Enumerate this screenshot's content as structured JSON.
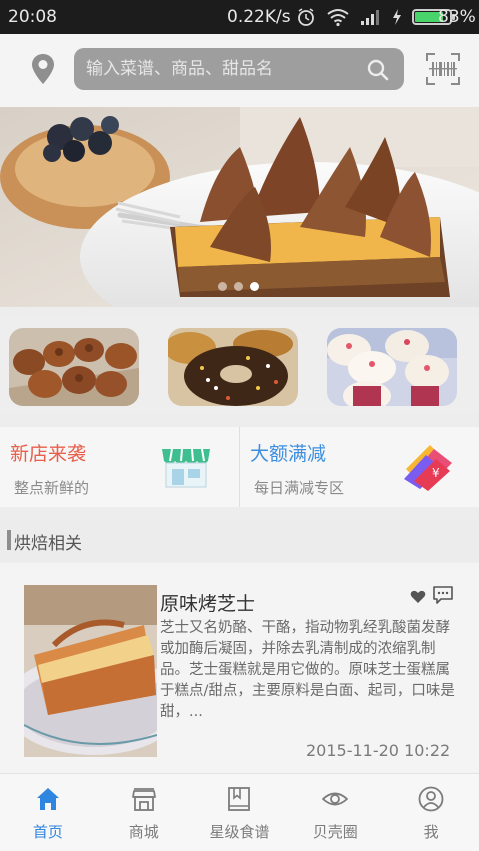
{
  "status_bar": {
    "time": "20:08",
    "network_speed": "0.22K/s",
    "battery_percent": "83%",
    "battery_level": 0.83,
    "icons": [
      "alarm-icon",
      "wifi-icon",
      "signal-icon",
      "charging-icon",
      "battery-icon"
    ]
  },
  "header": {
    "search_placeholder": "输入菜谱、商品、甜品名",
    "location_icon": "location-pin-icon",
    "search_icon": "search-icon",
    "scan_icon": "barcode-scan-icon"
  },
  "banner": {
    "slide_count": 3,
    "active_slide": 3
  },
  "promo": {
    "left": {
      "title": "新店来袭",
      "subtitle": "整点新鲜的",
      "title_color": "#e8604c",
      "icon": "shop-icon"
    },
    "right": {
      "title": "大额满减",
      "subtitle": "每日满减专区",
      "title_color": "#3d8fe0",
      "icon": "coupon-icon"
    }
  },
  "section": {
    "title": "烘焙相关"
  },
  "article": {
    "title": "原味烤芝士",
    "description": "芝士又名奶酪、干酪，指动物乳经乳酸菌发酵或加酶后凝固，并除去乳清制成的浓缩乳制品。芝士蛋糕就是用它做的。原味芝士蛋糕属于糕点/甜点，主要原料是白面、起司，口味是甜，...",
    "date": "2015-11-20 10:22"
  },
  "bottom_nav": {
    "active_color": "#2f86e0",
    "items": [
      {
        "label": "首页",
        "icon": "home-icon",
        "active": true
      },
      {
        "label": "商城",
        "icon": "store-icon",
        "active": false
      },
      {
        "label": "星级食谱",
        "icon": "book-icon",
        "active": false
      },
      {
        "label": "贝壳圈",
        "icon": "eye-icon",
        "active": false
      },
      {
        "label": "我",
        "icon": "user-icon",
        "active": false
      }
    ]
  }
}
